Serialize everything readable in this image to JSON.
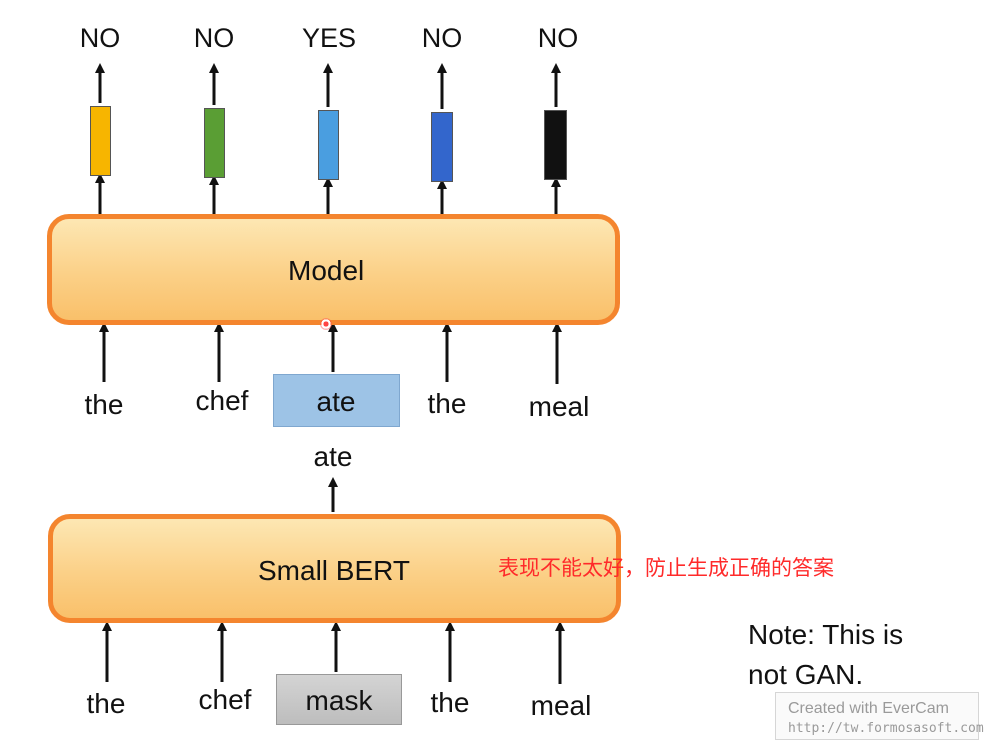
{
  "outputs": [
    "NO",
    "NO",
    "YES",
    "NO",
    "NO"
  ],
  "output_colors": [
    "#f7b500",
    "#5a9e34",
    "#4a9ee0",
    "#3366cc",
    "#111111"
  ],
  "model": {
    "label": "Model"
  },
  "model_inputs": [
    "the",
    "chef",
    "ate",
    "the",
    "meal"
  ],
  "generated_token": "ate",
  "small_bert": {
    "label": "Small BERT"
  },
  "bert_inputs": [
    "the",
    "chef",
    "mask",
    "the",
    "meal"
  ],
  "annotation": "表现不能太好，防止生成正确的答案",
  "note": {
    "line1": "Note: This is",
    "line2": "not GAN."
  },
  "watermark": {
    "line1": "Created with EverCam",
    "line2": "http://tw.formosasoft.com"
  },
  "colors": {
    "box_border": "#f4852e",
    "replaced_token_fill": "#9dc3e6",
    "mask_token_fill": "#c8c8c8",
    "annotation_red": "#ff2a2a"
  }
}
